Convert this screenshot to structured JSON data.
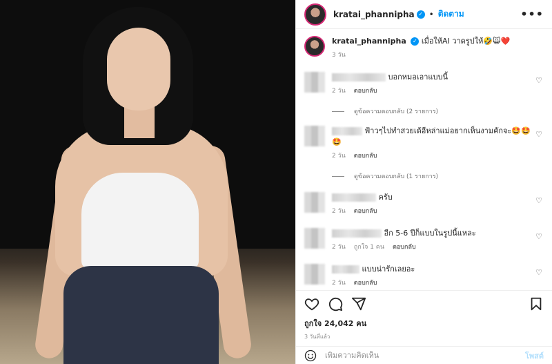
{
  "header": {
    "username": "kratai_phannipha",
    "follow_label": "ติดตาม",
    "more_label": "•••"
  },
  "caption": {
    "username": "kratai_phannipha",
    "text": "เมื่อให้AI วาดรูปให้🤣🙀❤️",
    "time": "3 วัน"
  },
  "comments": [
    {
      "text": "บอกหมอเอาแบบนี้",
      "time": "2 วัน",
      "reply_label": "ตอบกลับ",
      "likes": "",
      "view_replies": "ดูข้อความตอบกลับ (2 รายการ)"
    },
    {
      "text": "ฟ้าวๆไปทำสวยเด้อีหล่าแม่อยากเห็นงามคักจะ🤩🤩🤩",
      "time": "2 วัน",
      "reply_label": "ตอบกลับ",
      "likes": "",
      "view_replies": "ดูข้อความตอบกลับ (1 รายการ)"
    },
    {
      "text": "ครับ",
      "time": "2 วัน",
      "reply_label": "ตอบกลับ",
      "likes": "",
      "view_replies": ""
    },
    {
      "text": "อีก 5-6 ปีก็แบบในรูปนี้แหละ",
      "time": "2 วัน",
      "reply_label": "ตอบกลับ",
      "likes": "ถูกใจ 1 คน",
      "view_replies": ""
    },
    {
      "text": "แบบน่ารักเลยอะ",
      "time": "2 วัน",
      "reply_label": "ตอบกลับ",
      "likes": "",
      "view_replies": ""
    }
  ],
  "likes_text": "ถูกใจ 24,042 คน",
  "date_text": "3 วันที่แล้ว",
  "add_comment": {
    "placeholder": "เพิ่มความคิดเห็น",
    "post_label": "โพสต์"
  },
  "icons": [
    "heart-icon",
    "comment-icon",
    "share-icon",
    "bookmark-icon",
    "emoji-icon"
  ],
  "colors": {
    "accent": "#0095f6",
    "story_ring": "#d62976"
  }
}
